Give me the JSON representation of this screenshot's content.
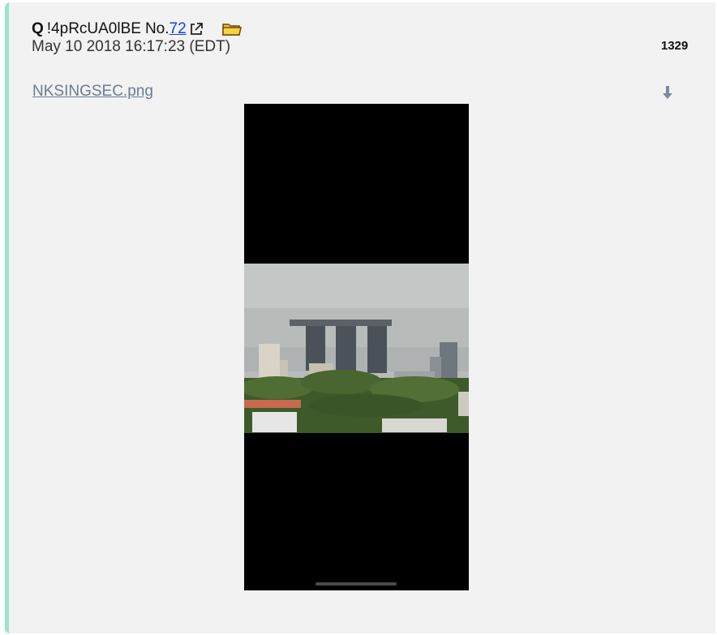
{
  "post": {
    "author": "Q",
    "tripcode": "!4pRcUA0lBE",
    "number_label": "No.",
    "number": "72",
    "timestamp": "May 10 2018 16:17:23 (EDT)",
    "reply_count": "1329",
    "attachment": {
      "filename": "NKSINGSEC.png",
      "description_icon": "photo-thumbnail"
    }
  },
  "icons": {
    "external_link": "external-link-icon",
    "folder": "folder-icon",
    "download": "download-icon"
  },
  "colors": {
    "accent_border": "#98e5cc",
    "link": "#1a3fe0",
    "filename": "#6b7b96",
    "folder": "#f1c232"
  }
}
